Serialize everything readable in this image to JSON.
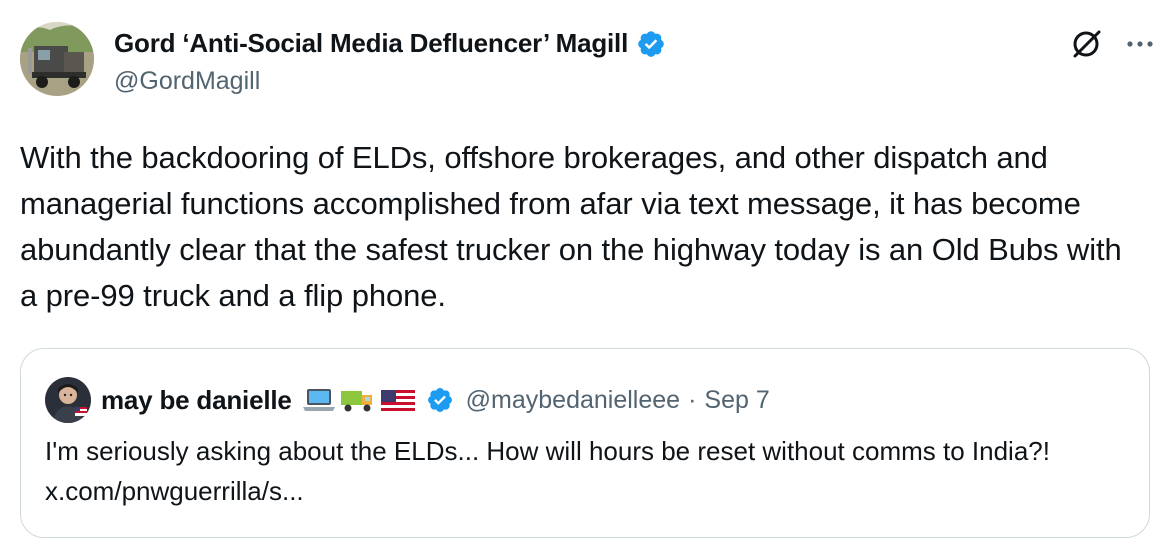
{
  "tweet": {
    "author": {
      "display_name": "Gord ‘Anti-Social Media Defluencer’ Magill",
      "handle": "@GordMagill",
      "verified": true,
      "avatar_icon": "avatar-truck-photo"
    },
    "text": "With the backdooring of ELDs, offshore brokerages, and other dispatch and managerial functions accomplished from afar via text message, it has become abundantly clear that the safest trucker on the highway today is an Old Bubs with a pre-99 truck and a flip phone.",
    "actions": {
      "grok_icon": "grok-icon",
      "more_icon": "more-icon"
    }
  },
  "quote": {
    "author": {
      "display_name": "may be danielle",
      "emoji": [
        "laptop-emoji",
        "truck-emoji",
        "us-flag-emoji"
      ],
      "verified": true,
      "handle": "@maybedanielleee",
      "separator": "·",
      "time": "Sep 7"
    },
    "text": "I'm seriously asking about the ELDs... How will hours be reset without comms to India?! x.com/pnwguerrilla/s..."
  },
  "colors": {
    "verified_blue": "#1d9bf0",
    "secondary_text": "#536471",
    "border": "#cfd9de",
    "text": "#0f1419"
  }
}
